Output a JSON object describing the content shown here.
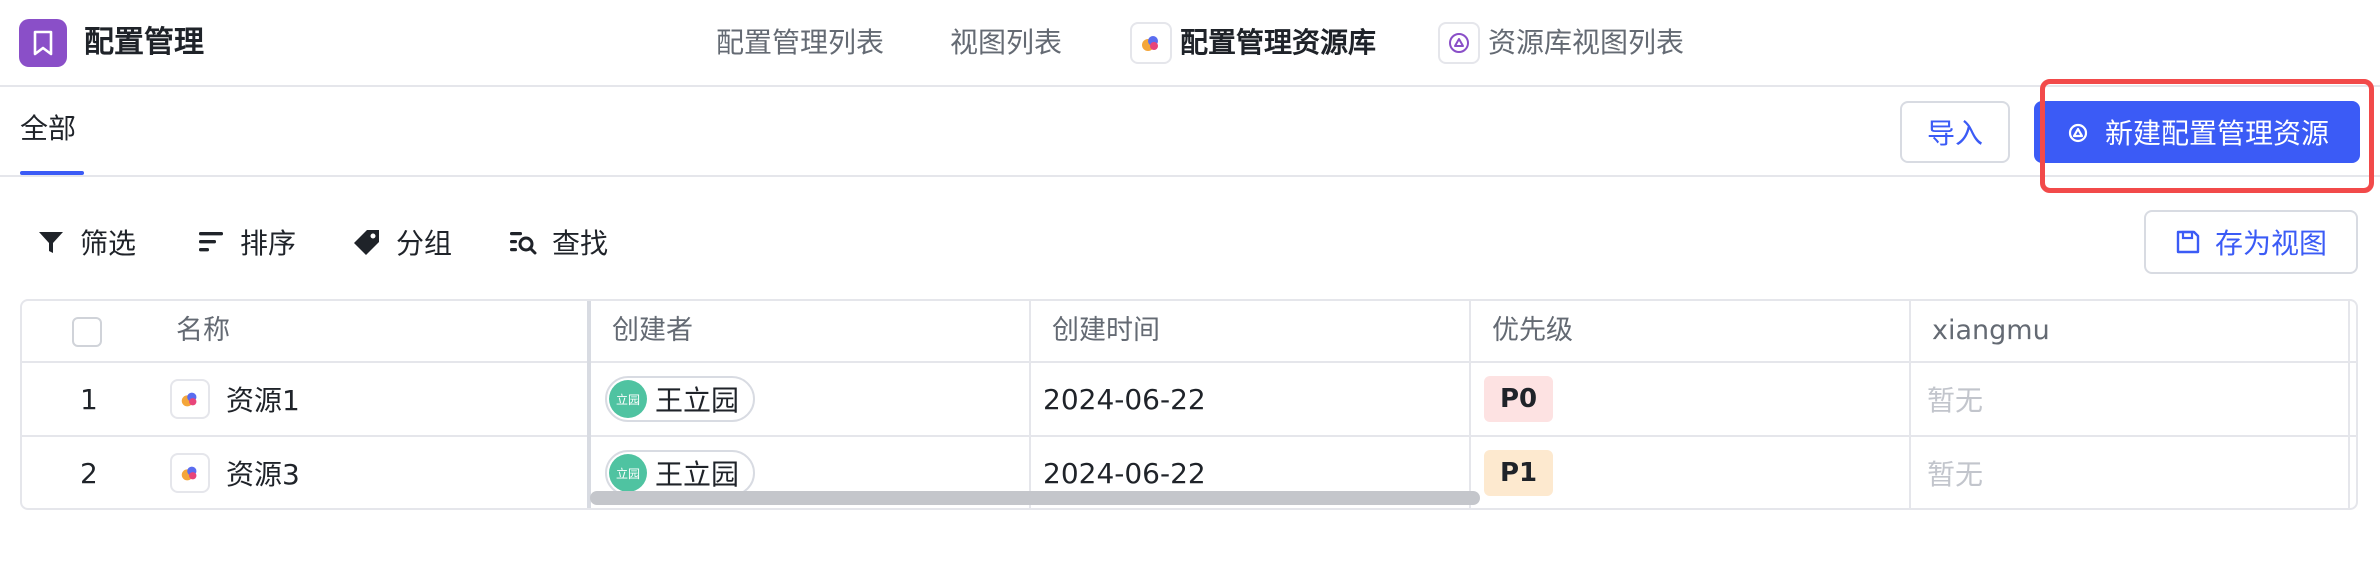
{
  "app": {
    "title": "配置管理"
  },
  "nav": [
    {
      "label": "配置管理列表"
    },
    {
      "label": "视图列表"
    },
    {
      "label": "配置管理资源库"
    },
    {
      "label": "资源库视图列表"
    }
  ],
  "views": {
    "active_tab": "全部"
  },
  "actions": {
    "import_label": "导入",
    "new_label": "新建配置管理资源",
    "save_view_label": "存为视图"
  },
  "toolbar": {
    "filter_label": "筛选",
    "sort_label": "排序",
    "group_label": "分组",
    "find_label": "查找"
  },
  "table": {
    "columns": [
      "名称",
      "创建者",
      "创建时间",
      "优先级",
      "xiangmu"
    ],
    "rows": [
      {
        "index": "1",
        "name": "资源1",
        "creator": "王立园",
        "avatar_text": "立园",
        "created": "2024-06-22",
        "priority": "P0",
        "xiangmu": "暂无"
      },
      {
        "index": "2",
        "name": "资源3",
        "creator": "王立园",
        "avatar_text": "立园",
        "created": "2024-06-22",
        "priority": "P1",
        "xiangmu": "暂无"
      }
    ]
  },
  "colors": {
    "accent": "#3b5bf6",
    "app_logo": "#8a4fc8",
    "highlight": "#f24a4a",
    "p0_bg": "#fde2e2",
    "p1_bg": "#fde9cf"
  }
}
